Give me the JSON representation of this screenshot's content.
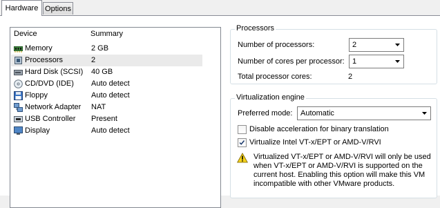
{
  "tabs": [
    {
      "label": "Hardware"
    },
    {
      "label": "Options"
    }
  ],
  "device_list": {
    "col_device": "Device",
    "col_summary": "Summary",
    "rows": [
      {
        "name": "Memory",
        "summary": "2 GB",
        "icon": "memory-icon"
      },
      {
        "name": "Processors",
        "summary": "2",
        "icon": "processor-icon"
      },
      {
        "name": "Hard Disk (SCSI)",
        "summary": "40 GB",
        "icon": "hard-disk-icon"
      },
      {
        "name": "CD/DVD (IDE)",
        "summary": "Auto detect",
        "icon": "cd-dvd-icon"
      },
      {
        "name": "Floppy",
        "summary": "Auto detect",
        "icon": "floppy-icon"
      },
      {
        "name": "Network Adapter",
        "summary": "NAT",
        "icon": "network-adapter-icon"
      },
      {
        "name": "USB Controller",
        "summary": "Present",
        "icon": "usb-controller-icon"
      },
      {
        "name": "Display",
        "summary": "Auto detect",
        "icon": "display-icon"
      }
    ]
  },
  "processors": {
    "legend": "Processors",
    "num_processors_label": "Number of processors:",
    "num_processors_value": "2",
    "cores_label": "Number of cores per processor:",
    "cores_value": "1",
    "total_label": "Total processor cores:",
    "total_value": "2"
  },
  "virtualization": {
    "legend": "Virtualization engine",
    "mode_label": "Preferred mode:",
    "mode_value": "Automatic",
    "disable_accel_label": "Disable acceleration for binary translation",
    "disable_accel_checked": false,
    "vt_label": "Virtualize Intel VT-x/EPT or AMD-V/RVI",
    "vt_checked": true,
    "warning_lines": [
      "Virtualized VT-x/EPT or AMD-V/RVI will only be used",
      "when VT-x/EPT or AMD-V/RVI is supported on the",
      "current host. Enabling this option will make this VM",
      "incompatible with other VMware products."
    ]
  },
  "colors": {
    "selection": "#eaeaea",
    "border": "#828790",
    "warning": "#f5d21b"
  }
}
